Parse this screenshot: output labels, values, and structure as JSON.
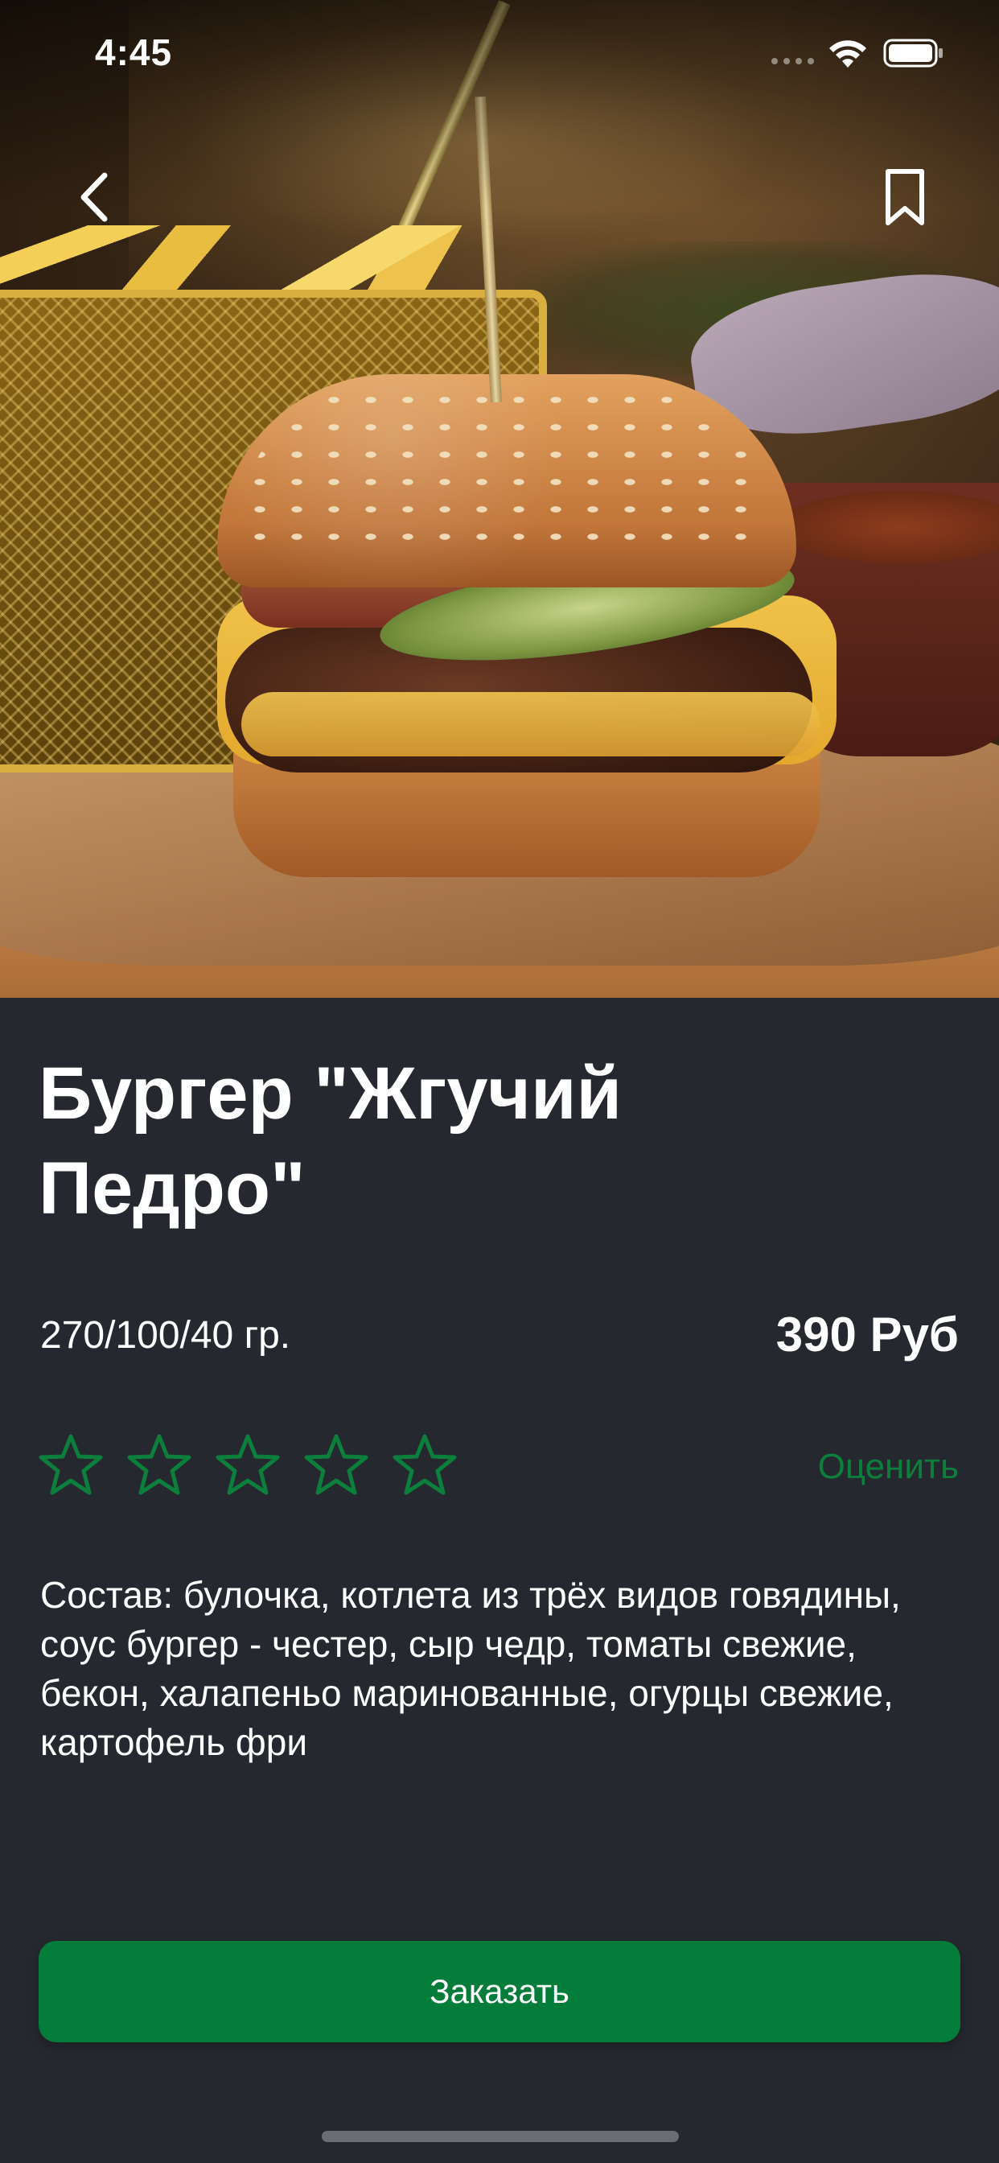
{
  "status_bar": {
    "time": "4:45"
  },
  "navigation": {
    "back_icon": "chevron-left-icon",
    "bookmark_icon": "bookmark-icon"
  },
  "hero_image": {
    "description_icon": "burger-photo"
  },
  "product": {
    "title": "Бургер \"Жгучий\nПедро\"",
    "weight": "270/100/40 гр.",
    "price": "390 Руб",
    "rating": {
      "value": 0,
      "max": 5,
      "rate_label": "Оценить"
    },
    "ingredients": "Состав: булочка, котлета из трёх видов говядины, соус бургер - честер, сыр чедр, томаты свежие, бекон, халапеньо маринованные, огурцы свежие, картофель фри"
  },
  "actions": {
    "order_label": "Заказать"
  },
  "colors": {
    "background": "#25282e",
    "accent_green": "#047d3b",
    "star_outline": "#0c7f3d",
    "text": "#ffffff"
  }
}
